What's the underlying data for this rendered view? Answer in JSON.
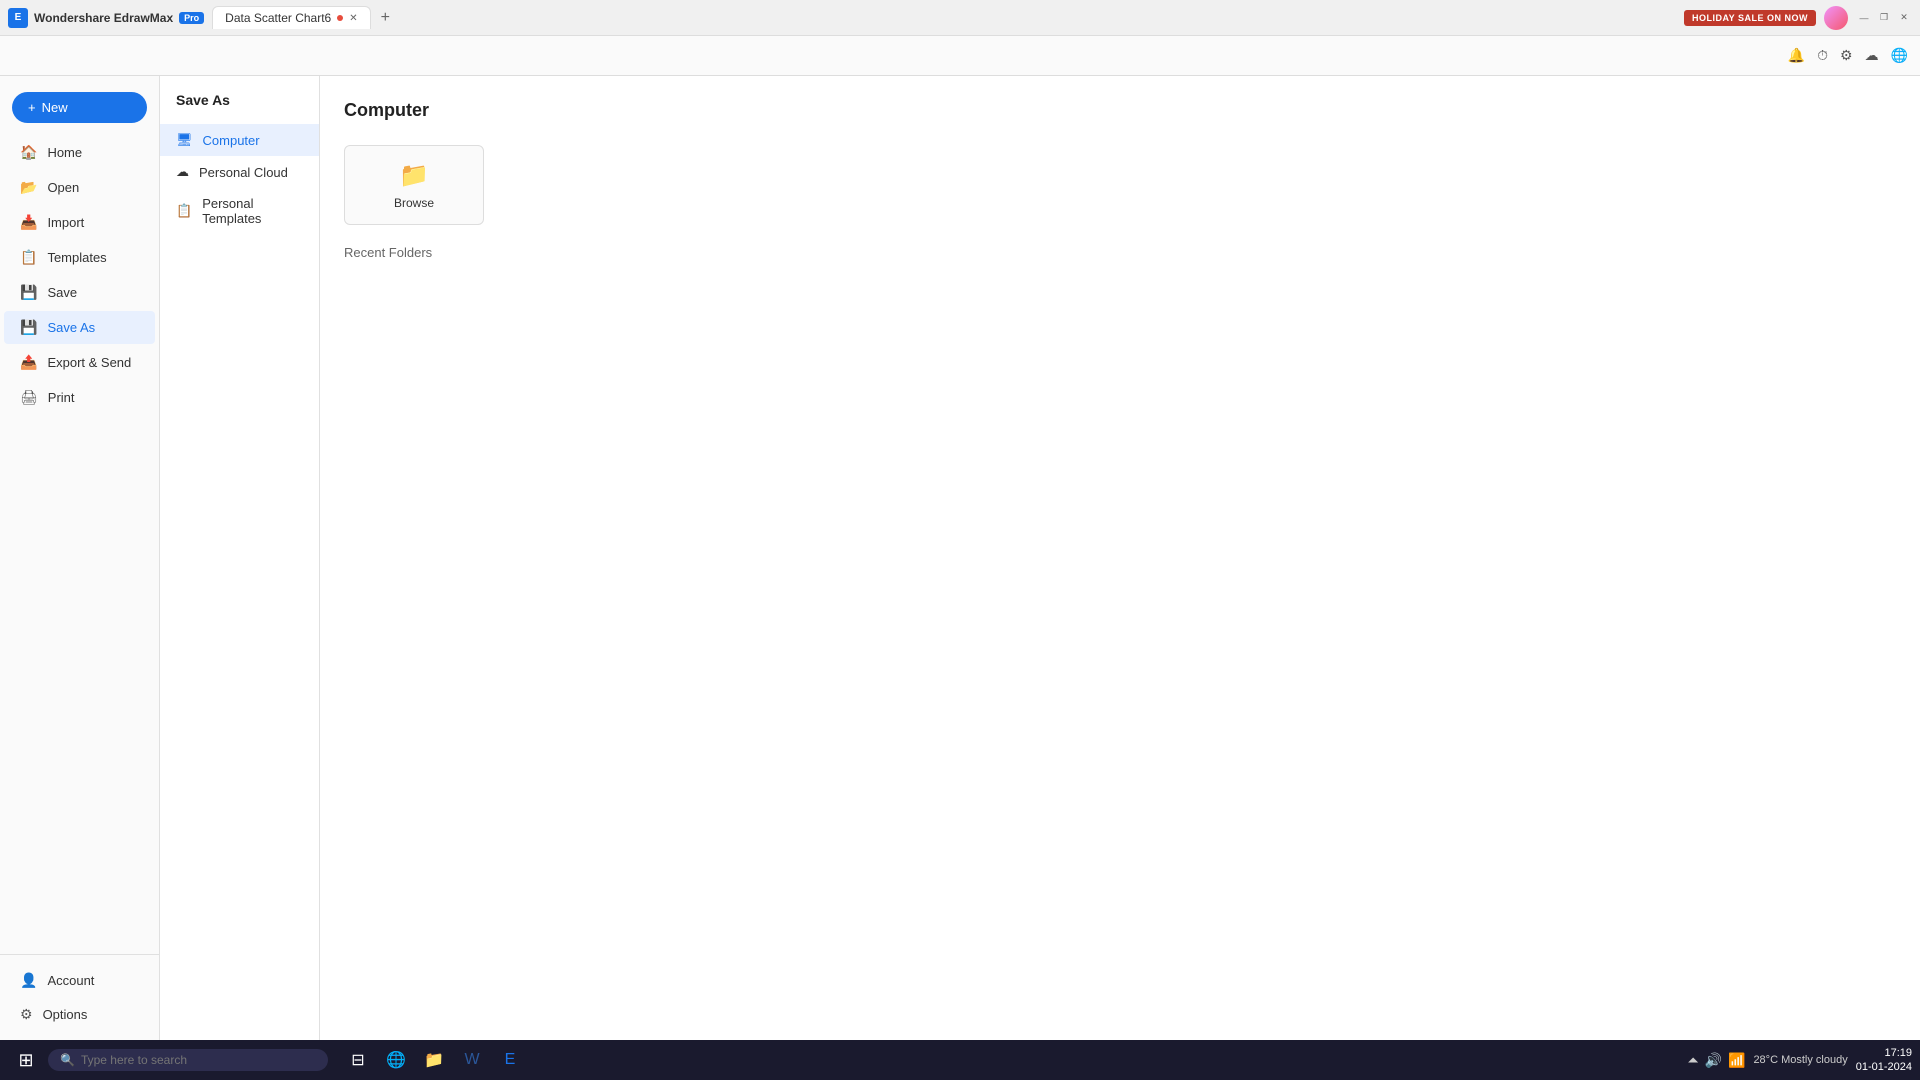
{
  "titlebar": {
    "app_name": "Wondershare EdrawMax",
    "pro_badge": "Pro",
    "tab_name": "Data Scatter Chart6",
    "holiday_btn": "HOLIDAY SALE ON NOW",
    "minimize": "—",
    "maximize": "❐",
    "close": "✕"
  },
  "toolbar": {
    "icons": [
      "🔔",
      "⏱",
      "⚙",
      "☁",
      "🌐"
    ]
  },
  "new_button": {
    "label": "New",
    "icon": "+"
  },
  "sidebar": {
    "items": [
      {
        "id": "home",
        "label": "Home",
        "icon": "🏠"
      },
      {
        "id": "open",
        "label": "Open",
        "icon": "📂"
      },
      {
        "id": "import",
        "label": "Import",
        "icon": "📥"
      },
      {
        "id": "templates",
        "label": "Templates",
        "icon": "📋"
      },
      {
        "id": "save",
        "label": "Save",
        "icon": "💾"
      },
      {
        "id": "save-as",
        "label": "Save As",
        "icon": "💾"
      },
      {
        "id": "export-send",
        "label": "Export & Send",
        "icon": "📤"
      },
      {
        "id": "print",
        "label": "Print",
        "icon": "🖨"
      }
    ],
    "bottom_items": [
      {
        "id": "account",
        "label": "Account",
        "icon": "👤"
      },
      {
        "id": "options",
        "label": "Options",
        "icon": "⚙"
      }
    ]
  },
  "secondary_sidebar": {
    "title": "Save As",
    "items": [
      {
        "id": "computer",
        "label": "Computer",
        "icon": "🖥",
        "active": true
      },
      {
        "id": "personal-cloud",
        "label": "Personal Cloud",
        "icon": "☁"
      },
      {
        "id": "personal-templates",
        "label": "Personal Templates",
        "icon": "📋"
      }
    ]
  },
  "main_content": {
    "title": "Computer",
    "browse_label": "Browse",
    "recent_folders_label": "Recent Folders"
  },
  "taskbar": {
    "search_placeholder": "Type here to search",
    "time": "17:19",
    "date": "01-01-2024",
    "weather": "28°C  Mostly cloudy"
  }
}
